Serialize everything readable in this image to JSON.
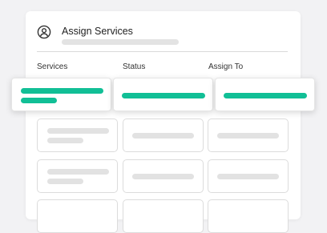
{
  "header": {
    "title": "Assign Services",
    "icon": "user-circle-icon"
  },
  "table": {
    "columns": [
      "Services",
      "Status",
      "Assign To"
    ]
  },
  "colors": {
    "accent": "#11bf96",
    "placeholder": "#e2e2e2",
    "border": "#dcdcdc"
  }
}
